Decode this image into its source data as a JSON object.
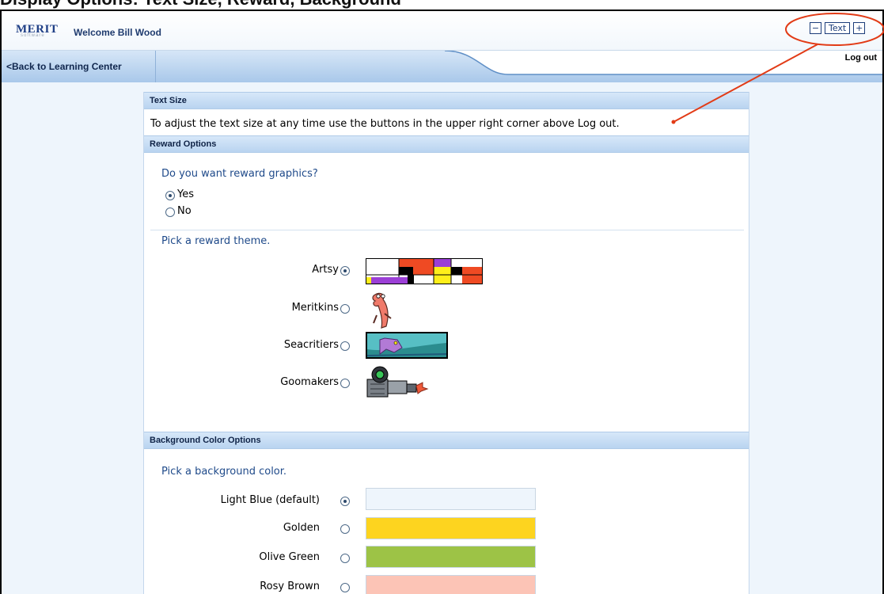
{
  "header": {
    "cut_title": "Display Options: Text Size, Reward, Background",
    "brand": "MERIT",
    "brand_sub": "software",
    "welcome": "Welcome Bill Wood",
    "text_minus": "−",
    "text_label": "Text",
    "text_plus": "+"
  },
  "nav": {
    "back": "<Back to Learning Center",
    "logout": "Log out"
  },
  "text_size": {
    "title": "Text Size",
    "instruction": "To adjust the text size at any time use the buttons in the upper right corner above Log out."
  },
  "reward": {
    "title": "Reward Options",
    "question": "Do you want reward graphics?",
    "yes": "Yes",
    "no": "No",
    "theme_prompt": "Pick a reward theme.",
    "themes": [
      {
        "label": "Artsy",
        "selected": true
      },
      {
        "label": "Meritkins",
        "selected": false
      },
      {
        "label": "Seacritiers",
        "selected": false
      },
      {
        "label": "Goomakers",
        "selected": false
      }
    ]
  },
  "background": {
    "title": "Background Color Options",
    "prompt": "Pick a background color.",
    "colors": [
      {
        "label": "Light Blue (default)",
        "hex": "#eef5fc",
        "selected": true
      },
      {
        "label": "Golden",
        "hex": "#fdd41f",
        "selected": false
      },
      {
        "label": "Olive Green",
        "hex": "#9dc346",
        "selected": false
      },
      {
        "label": "Rosy Brown",
        "hex": "#fcc4b6",
        "selected": false
      }
    ]
  },
  "colors": {
    "annotation": "#e23b16"
  }
}
